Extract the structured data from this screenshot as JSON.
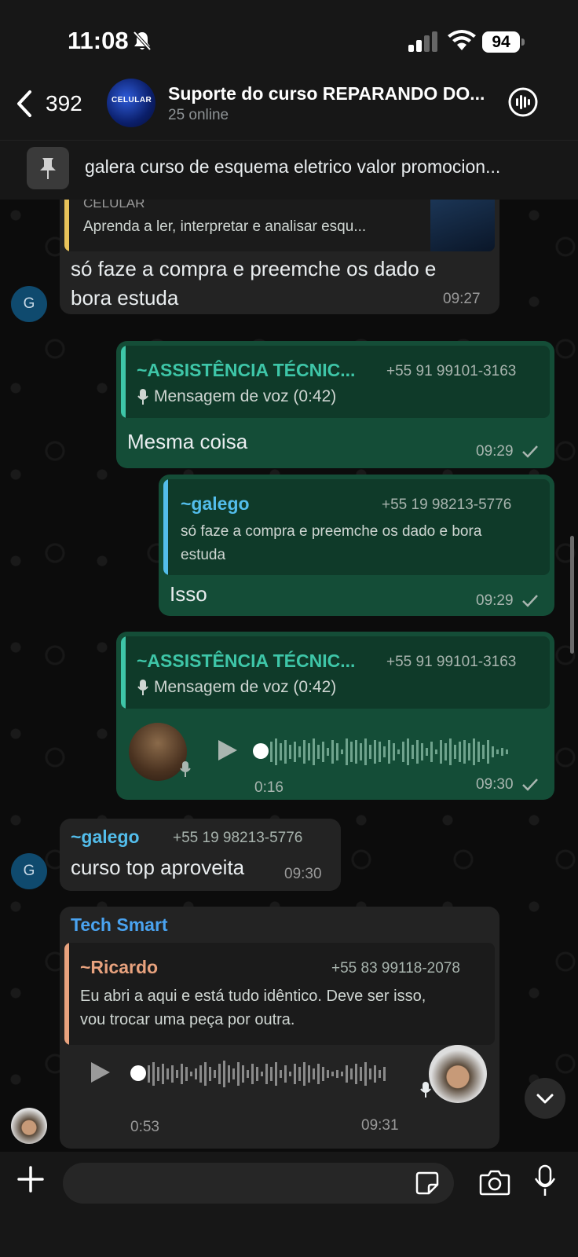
{
  "status_bar": {
    "time": "11:08",
    "battery": "94"
  },
  "header": {
    "back_count": "392",
    "title": "Suporte do curso REPARANDO DO...",
    "subtitle": "25 online"
  },
  "pinned": {
    "text": "galera curso de esquema eletrico valor promocion..."
  },
  "messages": {
    "m1": {
      "link_preview_desc": "Aprenda a ler, interpretar e analisar esqu...",
      "link_preview_title": "CELULAR",
      "text_line1": "só faze a compra e preemche os dado e",
      "text_line2": "bora estuda",
      "time": "09:27",
      "avatar_initial": "G"
    },
    "m2": {
      "quote_author": "~ASSISTÊNCIA TÉCNIC...",
      "quote_phone": "+55 91 99101-3163",
      "quote_text": "Mensagem de voz (0:42)",
      "text": "Mesma coisa",
      "time": "09:29"
    },
    "m3": {
      "quote_author": "~galego",
      "quote_phone": "+55 19 98213-5776",
      "quote_line1": "só faze a compra e preemche os dado e bora",
      "quote_line2": "estuda",
      "text": "Isso",
      "time": "09:29"
    },
    "m4": {
      "quote_author": "~ASSISTÊNCIA TÉCNIC...",
      "quote_phone": "+55 91 99101-3163",
      "quote_text": "Mensagem de voz (0:42)",
      "duration": "0:16",
      "time": "09:30"
    },
    "m5": {
      "author": "~galego",
      "phone": "+55 19 98213-5776",
      "text": "curso top  aproveita",
      "time": "09:30",
      "avatar_initial": "G"
    },
    "m6": {
      "author": "Tech Smart",
      "quote_author": "~Ricardo",
      "quote_phone": "+55 83 99118-2078",
      "quote_line1": "Eu abri a aqui e está tudo idêntico. Deve ser isso,",
      "quote_line2": "vou trocar uma peça por outra.",
      "duration": "0:53",
      "time": "09:31"
    }
  },
  "colors": {
    "bubble_out": "#144d37",
    "bubble_in": "#232323",
    "accent_teal": "#3ec6a8",
    "accent_blue": "#53bdeb",
    "accent_orange": "#e8a27e",
    "author_blue": "#4aa3f0"
  }
}
